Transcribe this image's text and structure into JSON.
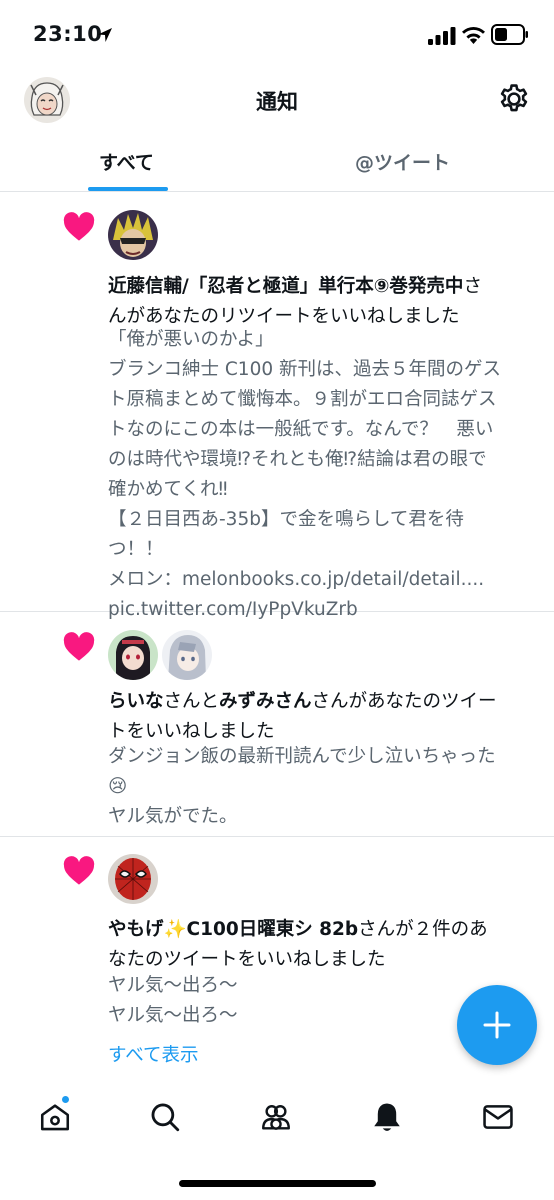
{
  "status_bar": {
    "time": "23:10",
    "icons": [
      "location-arrow-icon",
      "cellular-signal-icon",
      "wifi-icon",
      "battery-icon"
    ]
  },
  "header": {
    "title": "通知",
    "settings_icon": "gear-icon"
  },
  "tabs": [
    {
      "label": "すべて",
      "active": true
    },
    {
      "label": "@ツイート",
      "active": false
    }
  ],
  "notifications": [
    {
      "icon": "heart-icon",
      "users": [
        "近藤信輔/「忍者と極道」単行本⑨巻発売中"
      ],
      "action_lines": [
        "さんがあなたのリツイートをいいねしました"
      ],
      "heading_lines": [
        "近藤信輔/「忍者と極道」単行本⑨巻発売中さ",
        "んがあなたのリツイートをいいねしました"
      ],
      "body_lines": [
        "「俺が悪いのかよ」",
        "ブランコ紳士 C100 新刊は、過去５年間のゲス",
        "ト原稿まとめて懺悔本。９割がエロ合同誌ゲス",
        "トなのにこの本は一般紙です。なんで？　悪い",
        "のは時代や環境⁉︎それとも俺⁉︎結論は君の眼で",
        "確かめてくれ‼︎",
        "【２日目西あ-35b】で金を鳴らして君を待",
        "つ！！",
        "メロン：melonbooks.co.jp/detail/detail....",
        "pic.twitter.com/IyPpVkuZrb"
      ]
    },
    {
      "icon": "heart-icon",
      "user1": "らいな",
      "connector": "さんと",
      "user2": "みずみさん",
      "action_line1": "さんがあなたのツイー",
      "action_line2": "トをいいねしました",
      "body_lines": [
        "ダンジョン飯の最新刊読んで少し泣いちゃった",
        "😢",
        "ヤル気がでた。"
      ]
    },
    {
      "icon": "heart-icon",
      "user": "やもげ✨C100日曜東シ 82b",
      "action_line1": "さんが２件のあ",
      "action_line2": "なたのツイートをいいねしました",
      "body_lines": [
        "ヤル気〜出ろ〜",
        "ヤル気〜出ろ〜"
      ],
      "show_all": "すべて表示"
    }
  ],
  "fab": {
    "icon": "plus-icon",
    "color": "#1d9bf0"
  },
  "bottom_nav": {
    "items": [
      "home-icon",
      "search-icon",
      "communities-icon",
      "bell-icon",
      "mail-icon"
    ],
    "active": "bell-icon"
  },
  "colors": {
    "accent": "#1d9bf0",
    "like": "#f91880",
    "secondary_text": "#5b6670"
  }
}
